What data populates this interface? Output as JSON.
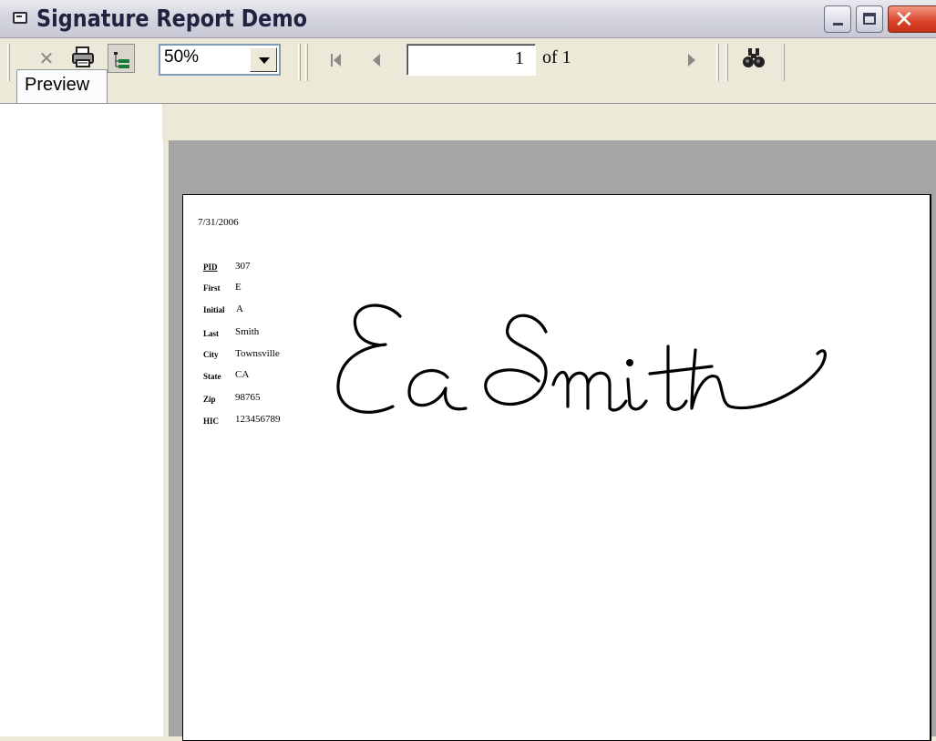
{
  "window": {
    "title": "Signature Report Demo"
  },
  "icons": {
    "app": "window-icon",
    "minimize": "minimize-icon",
    "maximize": "maximize-icon",
    "close": "close-x-icon",
    "toolbar_close": "x-icon",
    "print": "printer-icon",
    "toc": "table-of-contents-icon",
    "first": "first-page-icon",
    "prev": "previous-page-icon",
    "next": "next-page-icon",
    "find": "binoculars-icon"
  },
  "toolbar": {
    "zoom": "50%",
    "page_number": "1",
    "page_count": "of 1"
  },
  "tabs": [
    {
      "label": "Preview"
    }
  ],
  "report": {
    "date": "7/31/2006",
    "fields": [
      {
        "label": "PID",
        "value": "307"
      },
      {
        "label": "First",
        "value": "E"
      },
      {
        "label": "Initial",
        "value": "A"
      },
      {
        "label": "Last",
        "value": "Smith"
      },
      {
        "label": "City",
        "value": "Townsville"
      },
      {
        "label": "State",
        "value": "CA"
      },
      {
        "label": "Zip",
        "value": "98765"
      },
      {
        "label": "HIC",
        "value": "123456789"
      }
    ],
    "signature_text": "Ea Smith"
  },
  "colors": {
    "title_text": "#1e2340",
    "preview_bg": "#a5a5a5",
    "window_bg": "#ece9d8",
    "close_button": "#d9432a"
  }
}
